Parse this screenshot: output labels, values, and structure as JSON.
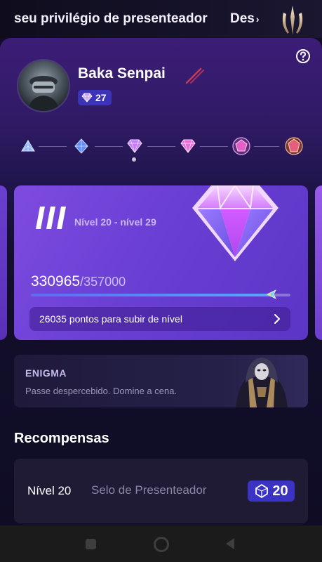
{
  "banner": {
    "text": "seu privilégio de presenteador",
    "link_label": "Des",
    "link_icon": "chevron-right-icon",
    "logo_icon": "trident-emblem-icon"
  },
  "profile": {
    "name": "Baka Senpai",
    "badge_value": "27",
    "help_icon": "question-circle-icon"
  },
  "level_card": {
    "range_label": "Nível 20 - nível 29",
    "points_current": "330965",
    "points_max": "/357000",
    "progress": 0.927,
    "next_level_text": "26035 pontos para subir de nível"
  },
  "enigma": {
    "title": "ENIGMA",
    "subtitle": "Passe despercebido. Domine a cena."
  },
  "rewards": {
    "title": "Recompensas",
    "items": [
      {
        "level": "Nível 20",
        "name": "Selo de Presenteador",
        "value": "20"
      }
    ]
  },
  "colors": {
    "accent": "#6a3fd4",
    "badge": "#3a33c4",
    "background": "#120f24"
  }
}
